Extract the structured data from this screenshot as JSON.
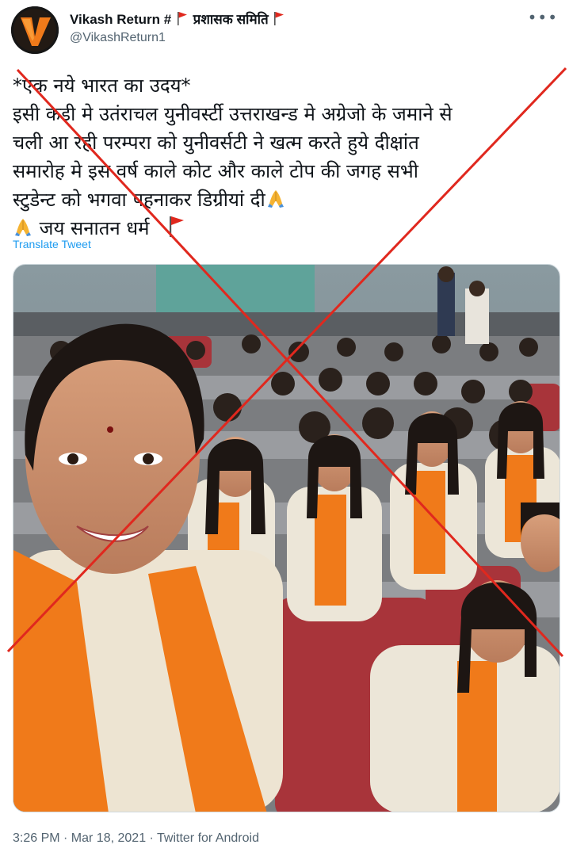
{
  "user": {
    "display_name": "Vikash Return #",
    "display_name_suffix": "प्रशासक समिति",
    "handle": "@VikashReturn1",
    "avatar_letter": "V"
  },
  "tweet": {
    "lines": [
      "*एक नये भारत का उदय*",
      "इसी कडी मे उतंराचल युनीवर्स्टी उत्तराखन्ड मे अग्रेजो के जमाने से",
      "चली आ रही परम्परा को युनीवर्सटी ने खत्म करते हुये दीक्षांत",
      "समारोह मे इस वर्ष काले कोट और काले टोप की जगह सभी",
      "स्टुडेन्ट को भगवा पहनाकर डिग्रीयां दी",
      "जय सनातन  धर्म"
    ],
    "translate_label": "Translate Tweet",
    "timestamp": "3:26 PM · Mar 18, 2021 · Twitter for Android"
  },
  "icons": {
    "flag": "red-flag-icon",
    "folded_hands": "folded-hands-icon",
    "more": "more-options-icon"
  },
  "colors": {
    "link": "#1d9bf0",
    "muted": "#536471",
    "cross": "#e0281e",
    "saffron": "#f07a1a"
  }
}
